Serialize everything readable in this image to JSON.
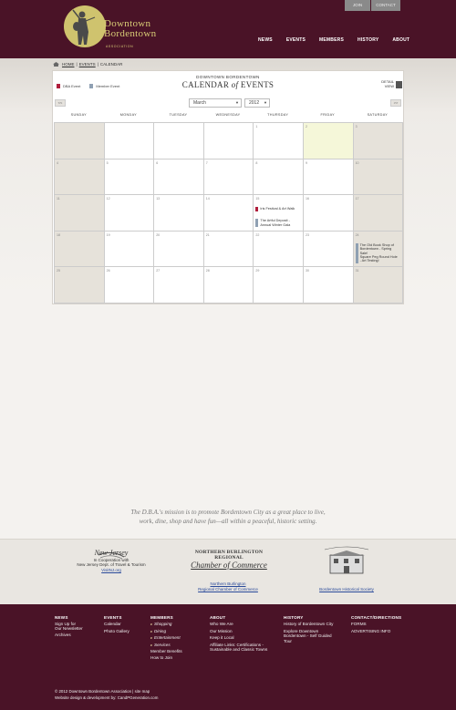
{
  "header": {
    "top_links": [
      "JOIN",
      "CONTACT"
    ],
    "logo_line1": "Downtown",
    "logo_line2": "Bordentown",
    "logo_sub": "ASSOCIATION",
    "nav": [
      "NEWS",
      "EVENTS",
      "MEMBERS",
      "HISTORY",
      "ABOUT"
    ]
  },
  "breadcrumb": {
    "home": "HOME",
    "events": "EVENTS",
    "current": "CALENDAR"
  },
  "calendar": {
    "kicker": "DOWNTOWN BORDENTOWN",
    "title_a": "CALENDAR",
    "title_of": "of",
    "title_b": "EVENTS",
    "legend": [
      {
        "label": "DBA Event",
        "color": "#b01e3c"
      },
      {
        "label": "Member Event",
        "color": "#8fa0b3"
      }
    ],
    "detail_view_line1": "DETAIL",
    "detail_view_line2": "VIEW",
    "month": "March",
    "year": "2012",
    "prev": "<<",
    "next": ">>",
    "weekdays": [
      "SUNDAY",
      "MONDAY",
      "TUESDAY",
      "WEDNESDAY",
      "THURSDAY",
      "FRIDAY",
      "SATURDAY"
    ],
    "weeks": [
      [
        {
          "n": "",
          "out": true
        },
        {
          "n": ""
        },
        {
          "n": ""
        },
        {
          "n": ""
        },
        {
          "n": "1"
        },
        {
          "n": "2",
          "today": true
        },
        {
          "n": "3",
          "out": true
        }
      ],
      [
        {
          "n": "4",
          "out": true
        },
        {
          "n": "5"
        },
        {
          "n": "6"
        },
        {
          "n": "7"
        },
        {
          "n": "8"
        },
        {
          "n": "9"
        },
        {
          "n": "10",
          "out": true
        }
      ],
      [
        {
          "n": "11",
          "out": true
        },
        {
          "n": "12"
        },
        {
          "n": "13"
        },
        {
          "n": "14"
        },
        {
          "n": "15"
        },
        {
          "n": "16"
        },
        {
          "n": "17",
          "out": true
        }
      ],
      [
        {
          "n": "18",
          "out": true
        },
        {
          "n": "19"
        },
        {
          "n": "20"
        },
        {
          "n": "21"
        },
        {
          "n": "22"
        },
        {
          "n": "23"
        },
        {
          "n": "24",
          "out": true
        }
      ],
      [
        {
          "n": "25",
          "out": true
        },
        {
          "n": "26"
        },
        {
          "n": "27"
        },
        {
          "n": "28"
        },
        {
          "n": "29"
        },
        {
          "n": "30"
        },
        {
          "n": "31",
          "out": true
        }
      ]
    ],
    "events": [
      {
        "week": 2,
        "day": 4,
        "text": "Iris Festival & Art Walk",
        "color": "#b01e3c",
        "slot": 0
      },
      {
        "week": 2,
        "day": 4,
        "text": "The Artful Deposit - Annual Winter Gala",
        "color": "#8fa0b3",
        "slot": 1
      },
      {
        "week": 3,
        "day": 6,
        "text": "The Old Book Shop of Bordentown - Spring Sale!",
        "color": "#8fa0b3",
        "slot": 0
      },
      {
        "week": 3,
        "day": 6,
        "text": "Square Peg Round Hole - Art Testing!",
        "color": "#8fa0b3",
        "slot": 1
      }
    ]
  },
  "mission": {
    "line1": "The D.B.A.'s mission is to promote Bordentown City as a great place to live,",
    "line2": "work, dine, shop and have fun—all within a peaceful, historic setting."
  },
  "partners": [
    {
      "logo_text": "New Jersey",
      "line1": "In Cooperation with",
      "line2": "New Jersey Dept. of Travel & Tourism",
      "link": "VisitNJ.org"
    },
    {
      "logo_text1": "NORTHERN BURLINGTON REGIONAL",
      "logo_text2": "Chamber of Commerce",
      "link1": "Northern Burlington",
      "link2": "Regional Chamber of Commerce"
    },
    {
      "link": "Bordentown Historical Society"
    }
  ],
  "footer": {
    "columns": [
      {
        "heading": "NEWS",
        "items": [
          "Sign Up for",
          "Our Newsletter",
          "Archives"
        ]
      },
      {
        "heading": "EVENTS",
        "items": [
          "Calendar",
          "Photo Gallery"
        ]
      },
      {
        "heading": "MEMBERS",
        "items": [
          "Shopping",
          "Dining",
          "Entertainment",
          "Services",
          "Member Benefits",
          "How to Join"
        ]
      },
      {
        "heading": "ABOUT",
        "items": [
          "Who We Are",
          "Our Mission",
          "Keep it Local",
          "Affiliate Links: Certifications -",
          "Sustainable and Classic Towns"
        ]
      },
      {
        "heading": "HISTORY",
        "items": [
          "History of Bordentown City",
          "Explore Downtown",
          "Bordentown - Self Guided",
          "Tour"
        ]
      },
      {
        "heading": "CONTACT/DIRECTIONS",
        "items": [
          "FORMS",
          "ADVERTISING INFO"
        ]
      }
    ],
    "copyright": "© 2012 Downtown Bordentown Association  |  site map",
    "credit": "Website design & development by: CandPGeneration.com"
  }
}
